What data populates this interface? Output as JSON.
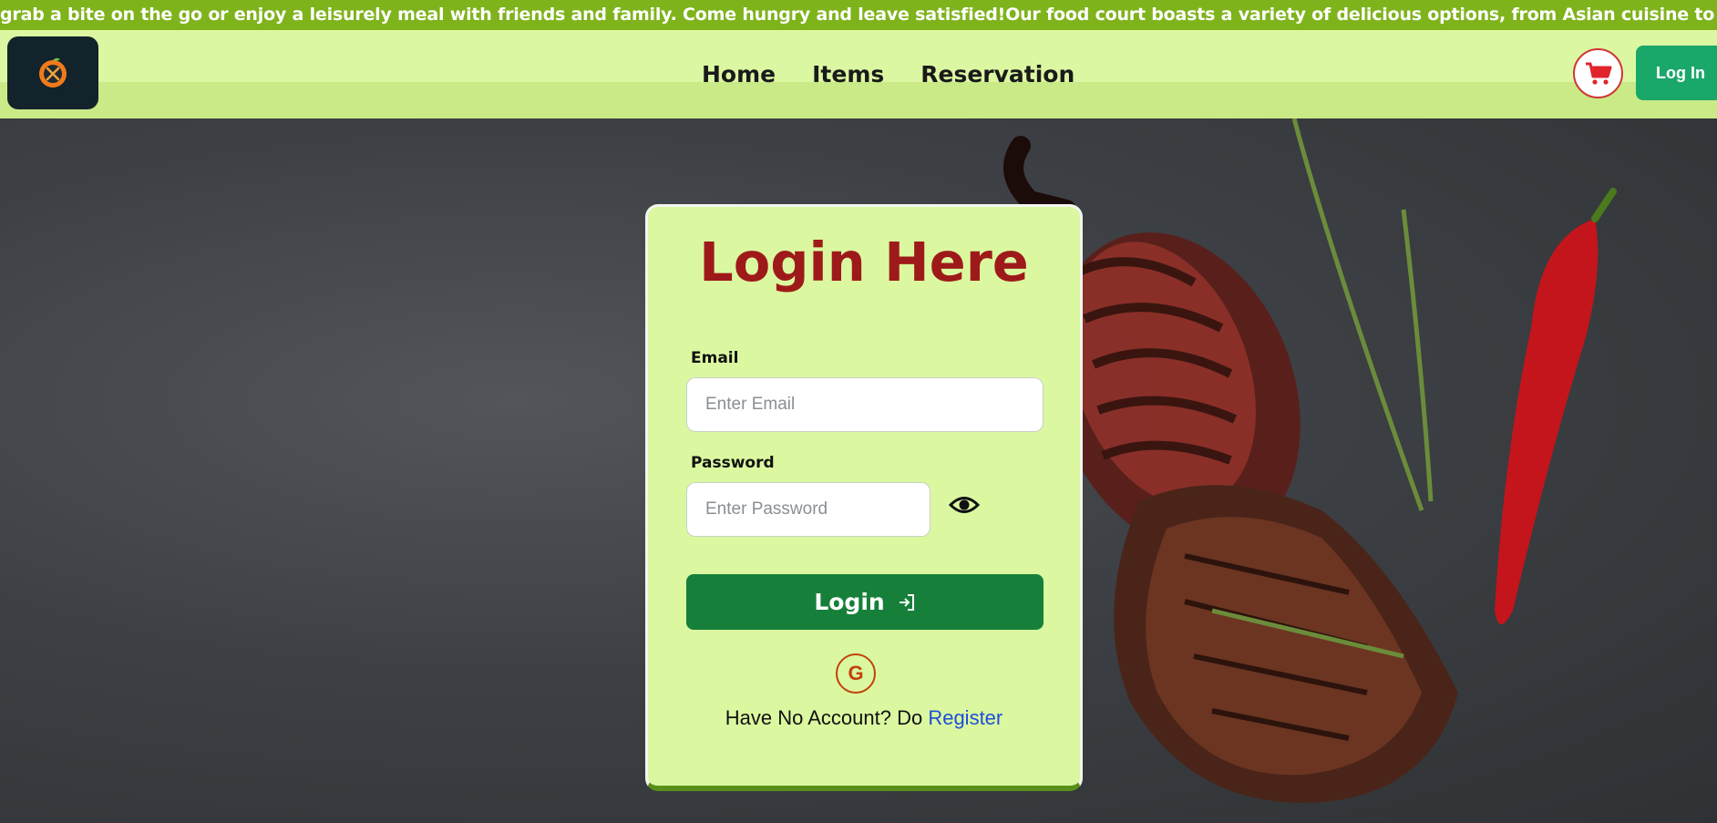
{
  "marquee": {
    "text": "grab a bite on the go or enjoy a leisurely meal with friends and family. Come hungry and leave satisfied!Our food court boasts a variety of delicious options, from Asian cuisine to pizza and sandwiches. With qu"
  },
  "navbar": {
    "logo_icon": "restaurant-logo-icon",
    "links": [
      {
        "label": "Home"
      },
      {
        "label": "Items"
      },
      {
        "label": "Reservation"
      }
    ],
    "cart_icon": "cart-icon",
    "login_label": "Log In"
  },
  "login_card": {
    "title": "Login Here",
    "email_label": "Email",
    "email_placeholder": "Enter Email",
    "email_value": "",
    "password_label": "Password",
    "password_placeholder": "Enter Password",
    "password_value": "",
    "toggle_icon": "eye-icon",
    "submit_label": "Login",
    "submit_icon": "login-arrow-icon",
    "google_icon": "google-icon",
    "google_letter": "G",
    "register_prompt": "Have No Account? Do",
    "register_link": "Register"
  },
  "colors": {
    "accent_green": "#16803a",
    "title_red": "#9e1a1a",
    "card_bg": "#dbf8a0",
    "nav_bg": "#dcf7a2",
    "marquee_bg": "#7fb31c",
    "link_blue": "#1d4ed8"
  }
}
